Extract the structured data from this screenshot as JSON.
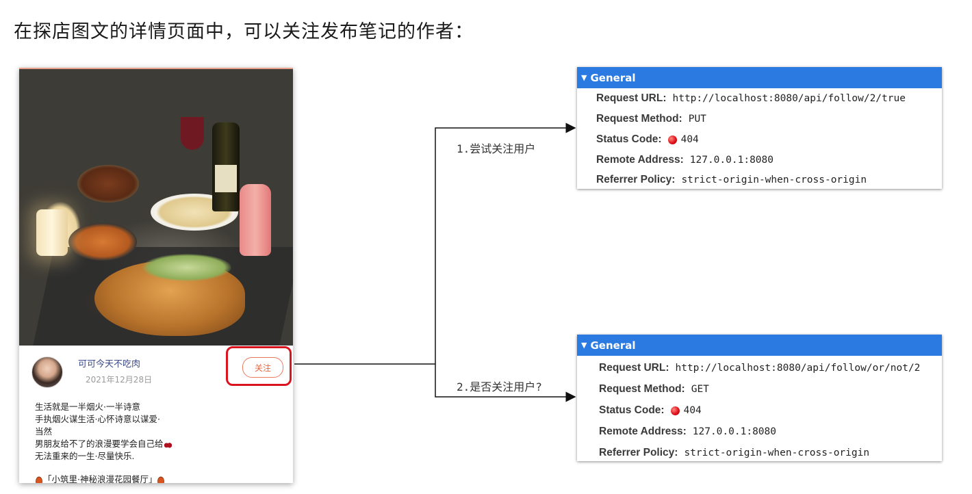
{
  "page_title": "在探店图文的详情页面中，可以关注发布笔记的作者：",
  "note": {
    "author_name": "可可今天不吃肉",
    "date": "2021年12月28日",
    "follow_label": "关注",
    "lines": [
      "生活就是一半烟火·一半诗意",
      "手执烟火谋生活·心怀诗意以谋爱·",
      "当然",
      "男朋友给不了的浪漫要学会自己给",
      "无法重来的一生·尽量快乐."
    ],
    "tag_line": "「小筑里·神秘浪漫花园餐厅」"
  },
  "steps": {
    "step1": "1.尝试关注用户",
    "step2": "2.是否关注用户?"
  },
  "panel1": {
    "header": "General",
    "rows": [
      {
        "key": "Request URL:",
        "value": "http://localhost:8080/api/follow/2/true"
      },
      {
        "key": "Request Method:",
        "value": "PUT"
      },
      {
        "key": "Status Code:",
        "value": "404"
      },
      {
        "key": "Remote Address:",
        "value": "127.0.0.1:8080"
      },
      {
        "key": "Referrer Policy:",
        "value": "strict-origin-when-cross-origin"
      }
    ]
  },
  "panel2": {
    "header": "General",
    "rows": [
      {
        "key": "Request URL:",
        "value": "http://localhost:8080/api/follow/or/not/2"
      },
      {
        "key": "Request Method:",
        "value": "GET"
      },
      {
        "key": "Status Code:",
        "value": "404"
      },
      {
        "key": "Remote Address:",
        "value": "127.0.0.1:8080"
      },
      {
        "key": "Referrer Policy:",
        "value": "strict-origin-when-cross-origin"
      }
    ]
  },
  "colors": {
    "panel_header": "#2a7ae2",
    "highlight_border": "#d9141e",
    "follow_text": "#e8643a",
    "status_dot": "#e0121c"
  }
}
